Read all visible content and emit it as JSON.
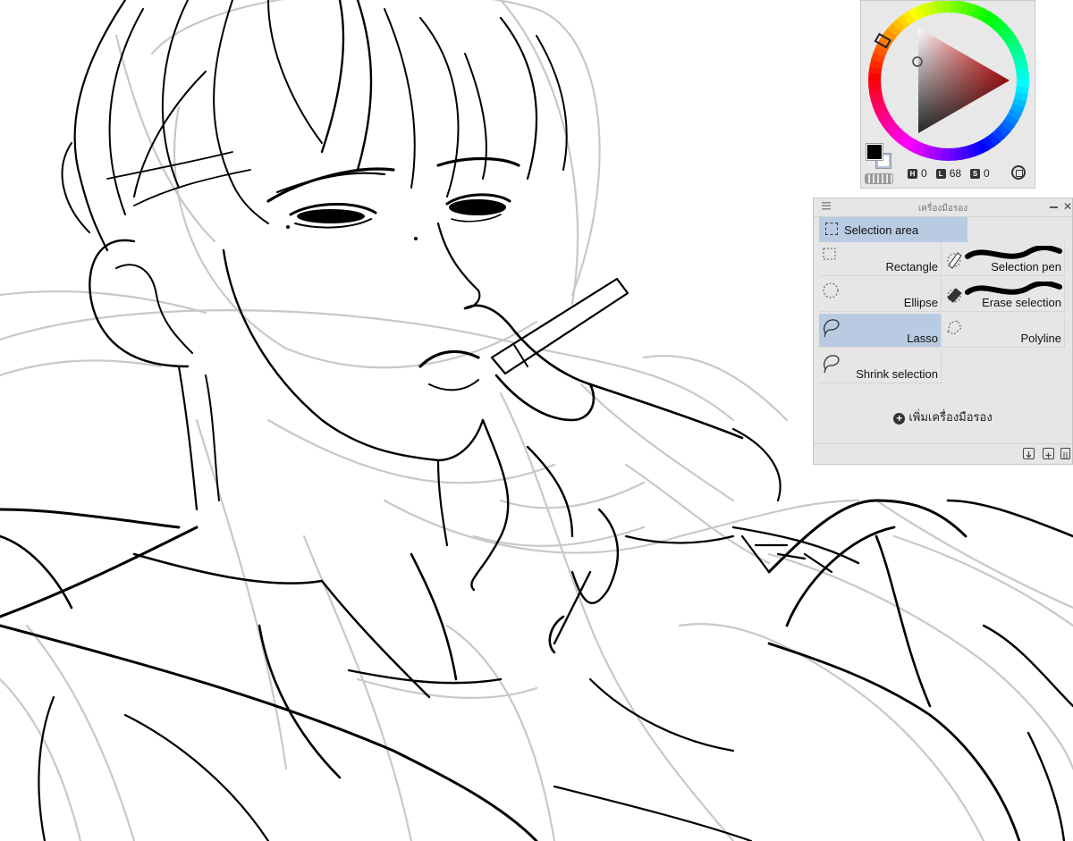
{
  "color_panel": {
    "main_color": "#000000",
    "sub_color": "#ffffff",
    "hsv": [
      {
        "key": "H",
        "value": "0"
      },
      {
        "key": "L",
        "value": "68"
      },
      {
        "key": "S",
        "value": "0"
      }
    ],
    "icons": [
      "color-wheel-icon",
      "color-triangle-icon",
      "swap-colors-icon",
      "wheel-mode-icon"
    ]
  },
  "subtool_panel": {
    "title": "เครื่องมือรอง",
    "group": "Selection area",
    "tools": [
      {
        "label": "Rectangle",
        "icon": "rectangle-select-icon",
        "active": false
      },
      {
        "label": "Selection pen",
        "icon": "selection-pen-icon",
        "active": false
      },
      {
        "label": "Ellipse",
        "icon": "ellipse-select-icon",
        "active": false
      },
      {
        "label": "Erase selection",
        "icon": "erase-selection-icon",
        "active": false
      },
      {
        "label": "Lasso",
        "icon": "lasso-icon",
        "active": true
      },
      {
        "label": "Polyline",
        "icon": "polyline-icon",
        "active": false
      },
      {
        "label": "Shrink selection",
        "icon": "shrink-selection-icon",
        "active": false
      }
    ],
    "add_label": "เพิ่มเครื่องมือรอง",
    "active_color": "#b8cbe2"
  },
  "canvas": {
    "line_color": "#000000",
    "sketch_color": "#c8c8c8"
  }
}
